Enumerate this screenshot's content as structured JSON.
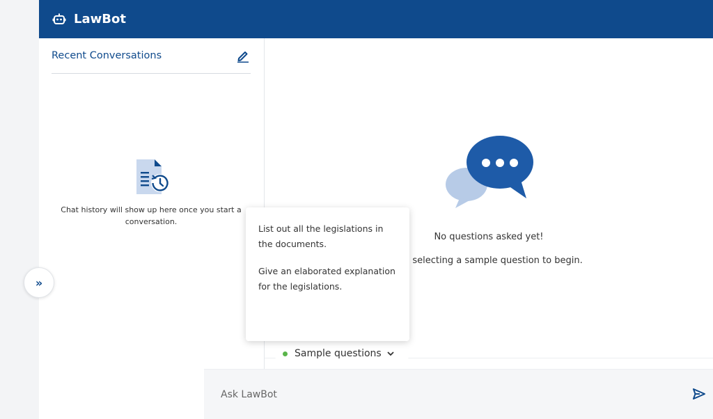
{
  "app": {
    "title": "LawBot",
    "brand_color": "#0f4a8c",
    "icon": "robot-icon"
  },
  "sidebar": {
    "title": "Recent Conversations",
    "new_chat_icon": "edit-icon",
    "empty_message": "Chat history will show up here once you start a conversation.",
    "empty_icon": "document-history-icon"
  },
  "toggle": {
    "label": "»",
    "icon": "double-chevron-right-icon"
  },
  "main": {
    "empty_title": "No questions asked yet!",
    "empty_hint": "by selecting a sample question to begin.",
    "empty_icon": "chat-bubbles-icon"
  },
  "samples": {
    "toggle_label": "Sample questions",
    "status_color": "#5ab54a",
    "questions": [
      "List out all the legislations in the documents.",
      "Give an elaborated explanation for the legislations."
    ]
  },
  "input": {
    "placeholder": "Ask LawBot",
    "send_icon": "send-icon"
  }
}
